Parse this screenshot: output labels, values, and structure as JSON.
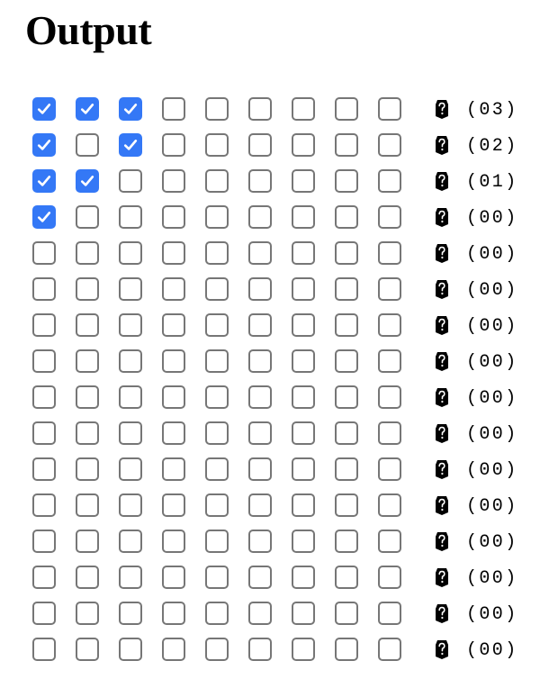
{
  "title": "Output",
  "rows": [
    {
      "checks": [
        true,
        true,
        true,
        false,
        false,
        false,
        false,
        false,
        false
      ],
      "count": "(03)",
      "icon": "gem-icon"
    },
    {
      "checks": [
        true,
        false,
        true,
        false,
        false,
        false,
        false,
        false,
        false
      ],
      "count": "(02)",
      "icon": "gem-icon"
    },
    {
      "checks": [
        true,
        true,
        false,
        false,
        false,
        false,
        false,
        false,
        false
      ],
      "count": "(01)",
      "icon": "gem-icon"
    },
    {
      "checks": [
        true,
        false,
        false,
        false,
        false,
        false,
        false,
        false,
        false
      ],
      "count": "(00)",
      "icon": "gem-icon"
    },
    {
      "checks": [
        false,
        false,
        false,
        false,
        false,
        false,
        false,
        false,
        false
      ],
      "count": "(00)",
      "icon": "gem-icon"
    },
    {
      "checks": [
        false,
        false,
        false,
        false,
        false,
        false,
        false,
        false,
        false
      ],
      "count": "(00)",
      "icon": "gem-icon"
    },
    {
      "checks": [
        false,
        false,
        false,
        false,
        false,
        false,
        false,
        false,
        false
      ],
      "count": "(00)",
      "icon": "gem-icon"
    },
    {
      "checks": [
        false,
        false,
        false,
        false,
        false,
        false,
        false,
        false,
        false
      ],
      "count": "(00)",
      "icon": "gem-icon"
    },
    {
      "checks": [
        false,
        false,
        false,
        false,
        false,
        false,
        false,
        false,
        false
      ],
      "count": "(00)",
      "icon": "gem-icon"
    },
    {
      "checks": [
        false,
        false,
        false,
        false,
        false,
        false,
        false,
        false,
        false
      ],
      "count": "(00)",
      "icon": "gem-icon"
    },
    {
      "checks": [
        false,
        false,
        false,
        false,
        false,
        false,
        false,
        false,
        false
      ],
      "count": "(00)",
      "icon": "gem-icon"
    },
    {
      "checks": [
        false,
        false,
        false,
        false,
        false,
        false,
        false,
        false,
        false
      ],
      "count": "(00)",
      "icon": "gem-icon"
    },
    {
      "checks": [
        false,
        false,
        false,
        false,
        false,
        false,
        false,
        false,
        false
      ],
      "count": "(00)",
      "icon": "gem-icon"
    },
    {
      "checks": [
        false,
        false,
        false,
        false,
        false,
        false,
        false,
        false,
        false
      ],
      "count": "(00)",
      "icon": "gem-icon"
    },
    {
      "checks": [
        false,
        false,
        false,
        false,
        false,
        false,
        false,
        false,
        false
      ],
      "count": "(00)",
      "icon": "gem-icon"
    },
    {
      "checks": [
        false,
        false,
        false,
        false,
        false,
        false,
        false,
        false,
        false
      ],
      "count": "(00)",
      "icon": "gem-icon"
    }
  ],
  "colors": {
    "checked": "#3478f6",
    "unchecked_border": "#767676",
    "checkmark": "#ffffff"
  }
}
